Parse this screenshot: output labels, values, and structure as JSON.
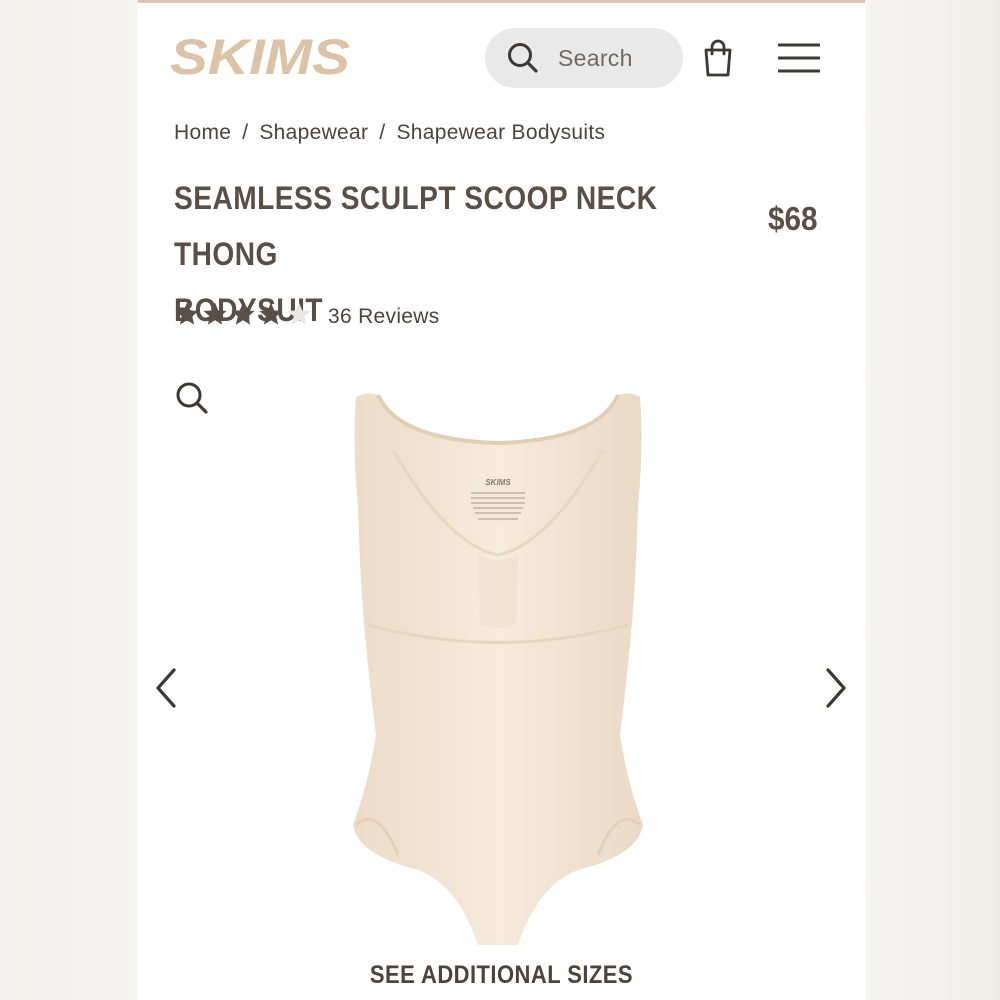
{
  "header": {
    "logo_text": "SKIMS",
    "search_label": "Search",
    "icons": [
      "search-icon",
      "shopping-bag-icon",
      "hamburger-menu-icon"
    ]
  },
  "breadcrumb": {
    "items": [
      "Home",
      "Shapewear",
      "Shapewear Bodysuits"
    ],
    "separator": "/"
  },
  "product": {
    "title_line1": "SEAMLESS SCULPT SCOOP NECK THONG",
    "title_line2": "BODYSUIT",
    "price": "$68",
    "rating": 4,
    "rating_max": 5,
    "reviews": "36 Reviews",
    "label_brand": "SKIMS"
  },
  "gallery": {
    "icons": [
      "zoom-icon",
      "chevron-left-icon",
      "chevron-right-icon"
    ],
    "see_sizes": "SEE ADDITIONAL SIZES"
  },
  "colors": {
    "accent": "#d9c6ad",
    "logo": "#dcc3a8",
    "text_dark": "#5a4f47",
    "garment": "#f3e5d4"
  }
}
